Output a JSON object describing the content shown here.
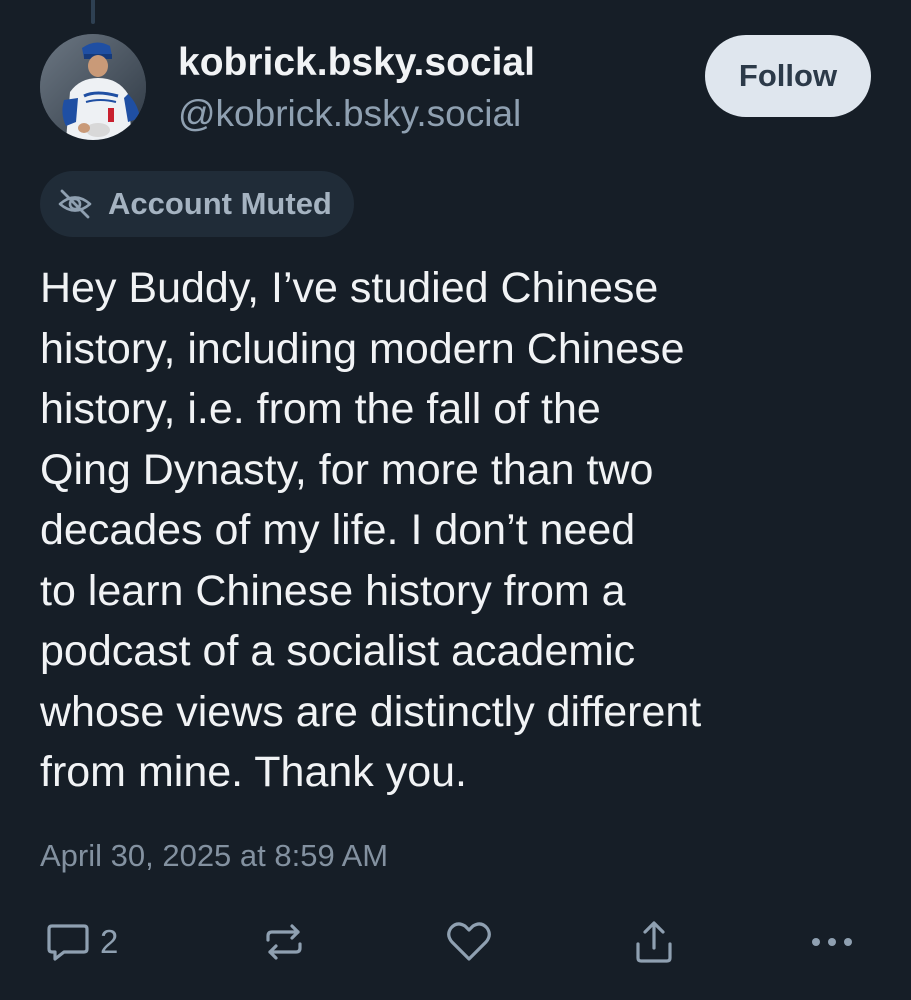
{
  "post": {
    "display_name": "kobrick.bsky.social",
    "handle": "@kobrick.bsky.social",
    "follow_label": "Follow",
    "muted_label": "Account Muted",
    "text": "Hey Buddy, I’ve studied Chinese\nhistory, including modern Chinese\nhistory, i.e. from the fall of the\nQing Dynasty, for more than two\ndecades of my life.  I don’t need\nto learn Chinese history from a\npodcast of a socialist academic\nwhose views are distinctly different\nfrom mine.  Thank you.",
    "timestamp": "April 30, 2025 at 8:59 AM"
  },
  "actions": {
    "reply_count": "2",
    "icons": [
      "reply-icon",
      "repost-icon",
      "like-icon",
      "share-icon",
      "more-icon"
    ]
  },
  "colors": {
    "background": "#161e27",
    "text": "#f1f3f5",
    "muted_text": "#8fa0b1",
    "follow_button_bg": "#dfe6ee",
    "badge_bg": "#202c38"
  }
}
